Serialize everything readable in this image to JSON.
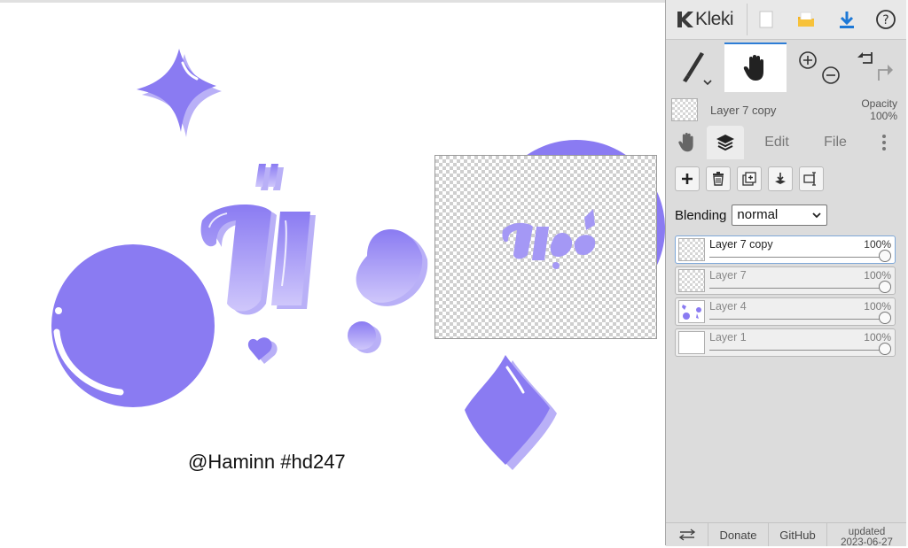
{
  "app": {
    "name": "Kleki"
  },
  "canvas": {
    "signature": "@Haminn #hd247",
    "artwork_text": "Hộc",
    "shape_color": "#8a7bf2",
    "shadow_color": "#b9b0f7"
  },
  "toolbar": {
    "icons": [
      "new-image-icon",
      "open-folder-icon",
      "download-icon",
      "help-icon"
    ]
  },
  "tools": {
    "brush": "brush-icon",
    "hand": "hand-icon",
    "zoom_in": "zoom-in-icon",
    "zoom_out": "zoom-out-icon",
    "undo": "undo-icon",
    "redo": "redo-icon"
  },
  "current_layer": {
    "name": "Layer 7 copy",
    "opacity_label": "Opacity",
    "opacity_value": "100%"
  },
  "tabs": {
    "edit": "Edit",
    "file": "File"
  },
  "blending": {
    "label": "Blending",
    "value": "normal"
  },
  "layers": [
    {
      "name": "Layer 7 copy",
      "opacity": "100%",
      "selected": true
    },
    {
      "name": "Layer 7",
      "opacity": "100%",
      "selected": false
    },
    {
      "name": "Layer 4",
      "opacity": "100%",
      "selected": false
    },
    {
      "name": "Layer 1",
      "opacity": "100%",
      "selected": false
    }
  ],
  "footer": {
    "donate": "Donate",
    "github": "GitHub",
    "updated_label": "updated",
    "updated_date": "2023-06-27"
  },
  "colors": {
    "accent": "#2e7dd6",
    "sidebar_bg": "#dcdcdc"
  }
}
